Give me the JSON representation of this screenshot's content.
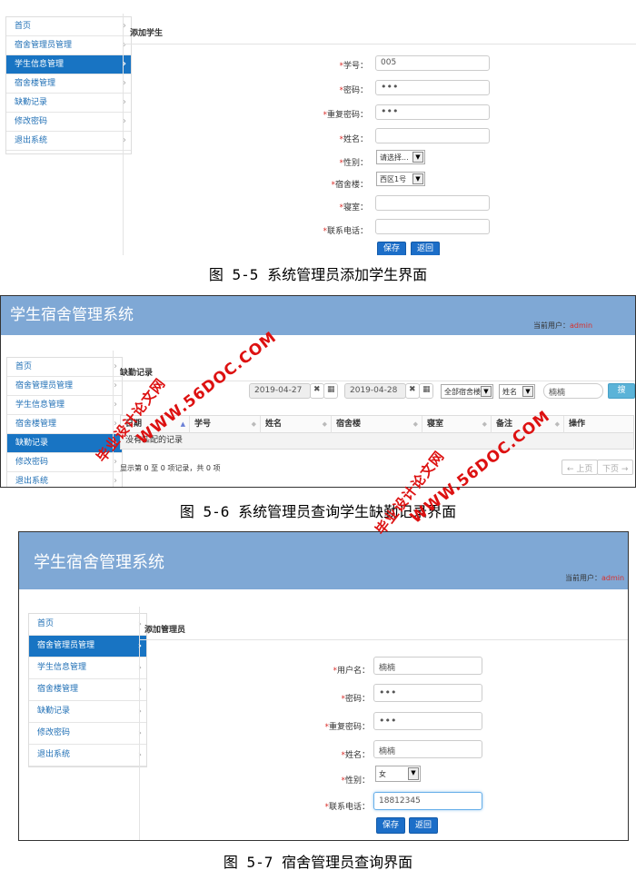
{
  "fig5": {
    "sidebar": [
      {
        "label": "首页"
      },
      {
        "label": "宿舍管理员管理"
      },
      {
        "label": "学生信息管理"
      },
      {
        "label": "宿舍楼管理"
      },
      {
        "label": "缺勤记录"
      },
      {
        "label": "修改密码"
      },
      {
        "label": "退出系统"
      }
    ],
    "panel_title": "添加学生",
    "fields": {
      "student_no": {
        "label": "学号：",
        "value": "005"
      },
      "password": {
        "label": "密码：",
        "value": "•••"
      },
      "password_confirm": {
        "label": "重复密码：",
        "value": "•••"
      },
      "name": {
        "label": "姓名：",
        "value": ""
      },
      "gender": {
        "label": "性别：",
        "value": "请选择..."
      },
      "building": {
        "label": "宿舍楼：",
        "value": "西区1号"
      },
      "room": {
        "label": "寝室：",
        "value": ""
      },
      "phone": {
        "label": "联系电话：",
        "value": ""
      }
    },
    "required_mark": "*",
    "save": "保存",
    "back": "返回",
    "caption": "图 5-5 系统管理员添加学生界面"
  },
  "fig6": {
    "brand": "学生宿舍管理系统",
    "user_label": "当前用户：",
    "user_name": "admin",
    "sidebar": [
      {
        "label": "首页"
      },
      {
        "label": "宿舍管理员管理"
      },
      {
        "label": "学生信息管理"
      },
      {
        "label": "宿舍楼管理"
      },
      {
        "label": "缺勤记录"
      },
      {
        "label": "修改密码"
      },
      {
        "label": "退出系统"
      }
    ],
    "panel_title": "缺勤记录",
    "date_from": "2019-04-27",
    "date_to": "2019-04-28",
    "building_filter": "全部宿舍楼",
    "field_filter": "姓名",
    "keyword": "楠楠",
    "search": "搜索",
    "columns": [
      "日期",
      "学号",
      "姓名",
      "宿舍楼",
      "寝室",
      "备注",
      "操作"
    ],
    "empty_row": "没有匹配的记录",
    "pager_info": "显示第 0 至 0 项记录，共 0 项",
    "prev": "← 上页",
    "next": "下页 →",
    "caption": "图 5-6 系统管理员查询学生缺勤记录界面"
  },
  "fig7": {
    "brand": "学生宿舍管理系统",
    "user_label": "当前用户：",
    "user_name": "admin",
    "sidebar": [
      {
        "label": "首页"
      },
      {
        "label": "宿舍管理员管理"
      },
      {
        "label": "学生信息管理"
      },
      {
        "label": "宿舍楼管理"
      },
      {
        "label": "缺勤记录"
      },
      {
        "label": "修改密码"
      },
      {
        "label": "退出系统"
      }
    ],
    "panel_title": "添加管理员",
    "fields": {
      "username": {
        "label": "用户名：",
        "value": "楠楠"
      },
      "password": {
        "label": "密码：",
        "value": "•••"
      },
      "password_confirm": {
        "label": "重复密码：",
        "value": "•••"
      },
      "name": {
        "label": "姓名：",
        "value": "楠楠"
      },
      "gender": {
        "label": "性别：",
        "value": "女"
      },
      "phone": {
        "label": "联系电话：",
        "value": "18812345"
      }
    },
    "required_mark": "*",
    "save": "保存",
    "back": "返回",
    "caption": "图 5-7 宿舍管理员查询界面"
  },
  "watermarks": {
    "site": "WWW.56DOC.COM",
    "org": "毕业设计论文网"
  },
  "colors": {
    "brand_bar": "#7fa8d5",
    "active_nav": "#1874c3",
    "button": "#1c6ec8",
    "watermark": "#dd1111"
  }
}
